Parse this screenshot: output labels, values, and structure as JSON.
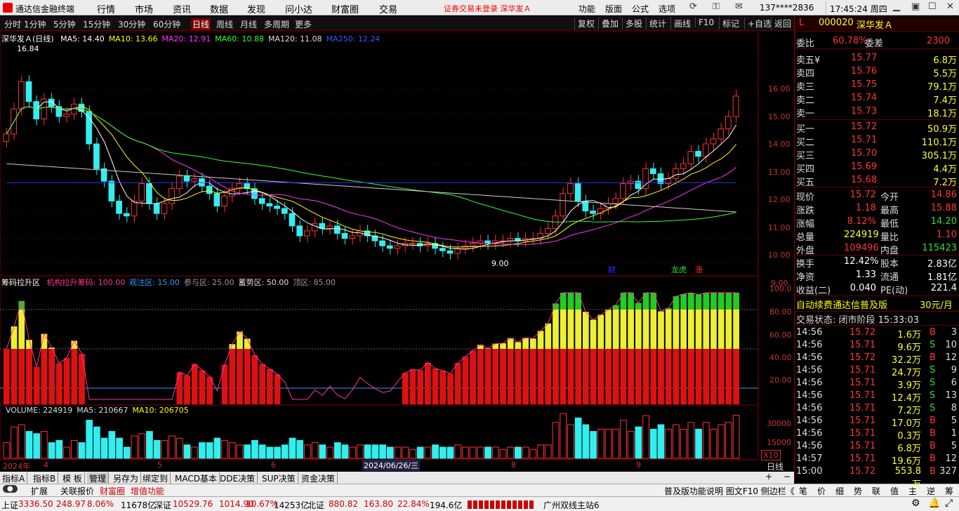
{
  "app": {
    "title": "通达信金融终端",
    "notice": "证券交易未登录  深华发Ａ",
    "user": "137****2836",
    "clock": "17:45:24 周四"
  },
  "menus": [
    "行情",
    "市场",
    "资讯",
    "数据",
    "发现",
    "问小达",
    "财富圈",
    "交易"
  ],
  "right_menus": [
    "功能",
    "版面",
    "公式",
    "选项"
  ],
  "period_tabs": [
    "分时",
    "1分钟",
    "5分钟",
    "15分钟",
    "30分钟",
    "60分钟",
    "日线",
    "周线",
    "月线",
    "多周期",
    "更多"
  ],
  "active_period": "日线",
  "tool_buttons": [
    "复权",
    "叠加",
    "多股",
    "统计",
    "画线",
    "F10",
    "标记",
    "+自选",
    "返回"
  ],
  "main_panel": {
    "name": "深华发Ａ(日线)",
    "ma": [
      {
        "label": "MA5: 14.40",
        "color": "#ffffff"
      },
      {
        "label": "MA10: 13.66",
        "color": "#ffff00"
      },
      {
        "label": "MA20: 12.91",
        "color": "#ff33ff"
      },
      {
        "label": "MA60: 10.88",
        "color": "#33ff33"
      },
      {
        "label": "MA120: 11.08",
        "color": "#dddddd"
      },
      {
        "label": "MA250: 12.24",
        "color": "#3355ff"
      }
    ],
    "high_mark": "16.84",
    "low_mark": "9.00",
    "yticks": [
      "16.00",
      "15.00",
      "14.00",
      "13.00",
      "12.00",
      "11.00",
      "10.00",
      "9.00"
    ],
    "tags": [
      "财",
      "龙虎",
      "涨"
    ]
  },
  "chip_panel": {
    "name": "筹码拉升区",
    "labels": [
      {
        "label": "机构拉升筹码: 100.00",
        "color": "#ff3399"
      },
      {
        "label": "观注区: 15.00",
        "color": "#3399ff"
      },
      {
        "label": "参与区: 25.00",
        "color": "#999999"
      },
      {
        "label": "蓄势区: 50.00",
        "color": "#dddddd"
      },
      {
        "label": "顶区: 85.00",
        "color": "#999999"
      }
    ],
    "yticks": [
      "100.0",
      "80.00",
      "60.00",
      "40.00",
      "20.00"
    ]
  },
  "volume_panel": {
    "labels": [
      {
        "label": "VOLUME: 224919",
        "color": "#dddddd"
      },
      {
        "label": "MA5: 210667",
        "color": "#dddddd"
      },
      {
        "label": "MA10: 206705",
        "color": "#ffff00"
      }
    ],
    "yticks": [
      "30000",
      "15000"
    ],
    "unit": "X10"
  },
  "x_axis": {
    "labels": [
      "2024年",
      "4",
      "5",
      "6",
      "2024/06/26/三",
      "8",
      "9"
    ],
    "period": "日线"
  },
  "quote": {
    "code": "000020",
    "name": "深华发Ａ",
    "weibi_label": "委比",
    "weibi": "60.78%",
    "weicha_label": "委差",
    "weicha": "2300",
    "asks": [
      {
        "label": "卖五¥",
        "price": "15.77",
        "vol": "6.8万"
      },
      {
        "label": "卖四",
        "price": "15.76",
        "vol": "5.5万"
      },
      {
        "label": "卖三",
        "price": "15.75",
        "vol": "79.1万"
      },
      {
        "label": "卖二",
        "price": "15.74",
        "vol": "7.4万"
      },
      {
        "label": "卖一",
        "price": "15.73",
        "vol": "18.1万"
      }
    ],
    "bids": [
      {
        "label": "买一",
        "price": "15.72",
        "vol": "50.9万"
      },
      {
        "label": "买二",
        "price": "15.71",
        "vol": "110.1万"
      },
      {
        "label": "买三",
        "price": "15.70",
        "vol": "305.1万"
      },
      {
        "label": "买四",
        "price": "15.69",
        "vol": "4.4万"
      },
      {
        "label": "买五",
        "price": "15.68",
        "vol": "7.2万"
      }
    ],
    "stats": [
      {
        "l1": "现价",
        "v1": "15.72",
        "c1": "#ff3333",
        "l2": "今开",
        "v2": "14.86",
        "c2": "#ff3333"
      },
      {
        "l1": "涨跌",
        "v1": "1.18",
        "c1": "#ff3333",
        "l2": "最高",
        "v2": "15.88",
        "c2": "#ff3333"
      },
      {
        "l1": "涨幅",
        "v1": "8.12%",
        "c1": "#ff3333",
        "l2": "最低",
        "v2": "14.20",
        "c2": "#33dd33"
      },
      {
        "l1": "总量",
        "v1": "224919",
        "c1": "#ffff33",
        "l2": "量比",
        "v2": "1.10",
        "c2": "#ff3333"
      },
      {
        "l1": "外盘",
        "v1": "109496",
        "c1": "#ff3333",
        "l2": "内盘",
        "v2": "115423",
        "c2": "#33dd33"
      }
    ],
    "stats2": [
      {
        "l1": "换手",
        "v1": "12.42%",
        "l2": "股本",
        "v2": "2.83亿"
      },
      {
        "l1": "净资",
        "v1": "1.33",
        "l2": "流通",
        "v2": "1.81亿"
      },
      {
        "l1": "收益(二)",
        "v1": "0.040",
        "l2": "PE(动)",
        "v2": "221.4"
      }
    ],
    "ad_text": "自动续费通达信普及版",
    "ad_price": "30元/月",
    "trade_status": "交易状态: 闭市阶段 15:33:03",
    "ticks": [
      {
        "t": "14:56",
        "p": "15.72",
        "v": "1.6万",
        "s": "B",
        "n": "3"
      },
      {
        "t": "14:56",
        "p": "15.71",
        "v": "9.6万",
        "s": "S",
        "n": "10"
      },
      {
        "t": "14:56",
        "p": "15.72",
        "v": "32.2万",
        "s": "B",
        "n": "12"
      },
      {
        "t": "14:56",
        "p": "15.71",
        "v": "24.7万",
        "s": "S",
        "n": "9"
      },
      {
        "t": "14:56",
        "p": "15.71",
        "v": "3.9万",
        "s": "S",
        "n": "6"
      },
      {
        "t": "14:56",
        "p": "15.71",
        "v": "12.4万",
        "s": "S",
        "n": "13"
      },
      {
        "t": "14:56",
        "p": "15.71",
        "v": "7.2万",
        "s": "S",
        "n": "8"
      },
      {
        "t": "14:56",
        "p": "15.71",
        "v": "17.0万",
        "s": "B",
        "n": "5"
      },
      {
        "t": "14:56",
        "p": "15.71",
        "v": "0.3万",
        "s": "B",
        "n": "1"
      },
      {
        "t": "14:56",
        "p": "15.71",
        "v": "6.8万",
        "s": "B",
        "n": "5"
      },
      {
        "t": "14:57",
        "p": "15.71",
        "v": "19.6万",
        "s": "B",
        "n": "12"
      },
      {
        "t": "15:00",
        "p": "15.72",
        "v": "553.8万",
        "s": "B",
        "n": "327"
      }
    ]
  },
  "bottom_tabs": [
    "指标A",
    "指标B",
    "模 板",
    "管理",
    "另存为",
    "绑定到",
    "MACD基本",
    "DDE决策",
    "SUP决策",
    "资金决策"
  ],
  "mid_tabs": [
    "扩展",
    "关联报价",
    "财富圈",
    "增值功能"
  ],
  "mid_right": "普及版功能说明 图文F10 侧边栏《",
  "right_tabs": [
    "笔",
    "价",
    "细",
    "势",
    "联",
    "值",
    "主",
    "逆",
    "筹"
  ],
  "status": {
    "sh_label": "上证",
    "sh": "3336.50",
    "sh_chg": "248.97",
    "sh_pct": "8.06%",
    "sh_amt": "11678亿",
    "sz_label": "深证",
    "sz": "10529.76",
    "sz_chg": "1014.90",
    "sz_pct": "10.67%",
    "sz_amt": "14253亿",
    "bz_label": "北证",
    "bz": "880.82",
    "bz_chg": "163.80",
    "bz_pct": "22.84%",
    "bz_amt": "194.6亿",
    "station": "广州双线主站6"
  },
  "chart_data": {
    "type": "candlestick",
    "ohlc_close_approx": [
      14.2,
      15.2,
      16.3,
      15.5,
      14.8,
      15.6,
      15.3,
      14.9,
      15.0,
      15.4,
      15.1,
      13.8,
      12.8,
      12.3,
      11.5,
      11.0,
      10.9,
      11.5,
      12.2,
      11.4,
      11.0,
      11.4,
      12.0,
      12.5,
      12.3,
      12.4,
      12.1,
      11.8,
      11.3,
      11.7,
      12.0,
      12.2,
      12.0,
      11.6,
      11.4,
      11.3,
      11.2,
      11.0,
      10.5,
      10.1,
      10.3,
      10.6,
      10.4,
      10.5,
      10.2,
      10.0,
      10.1,
      10.3,
      10.1,
      9.9,
      9.7,
      9.6,
      9.7,
      9.8,
      9.8,
      9.7,
      9.8,
      9.6,
      9.5,
      9.4,
      9.6,
      9.7,
      9.8,
      9.9,
      9.8,
      9.9,
      9.9,
      10.0,
      9.9,
      10.0,
      10.0,
      10.2,
      10.4,
      10.9,
      11.8,
      12.2,
      11.5,
      11.1,
      11.0,
      11.2,
      11.4,
      11.6,
      12.2,
      12.3,
      12.0,
      12.8,
      12.6,
      12.2,
      12.4,
      12.8,
      13.0,
      13.5,
      13.3,
      13.8,
      14.0,
      14.4,
      14.9,
      15.72
    ]
  }
}
